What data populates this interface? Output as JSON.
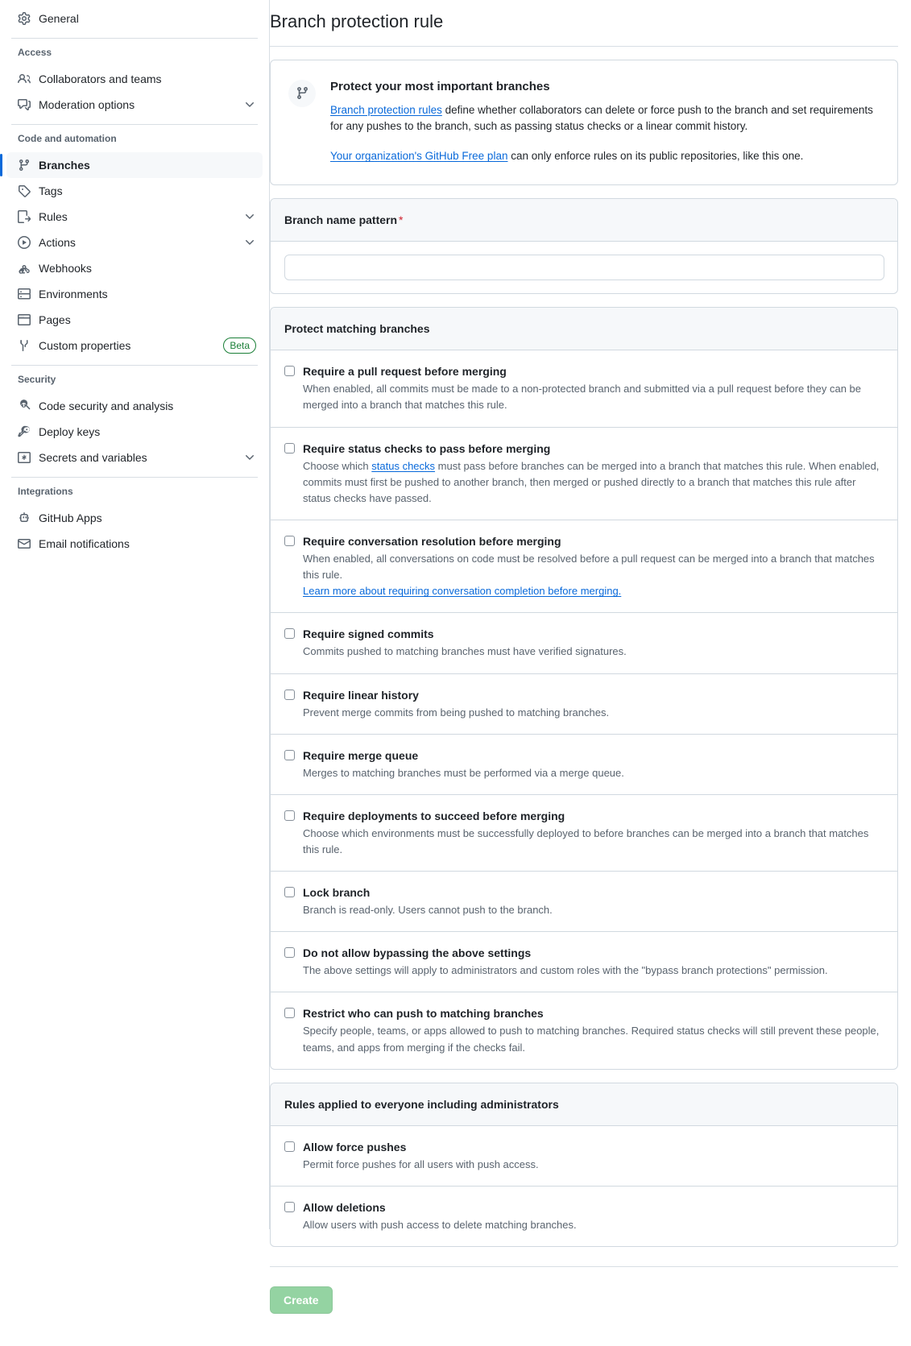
{
  "sidebar": {
    "top_items": [
      {
        "label": "General",
        "icon": "gear-icon",
        "name": "sidebar-item-general"
      }
    ],
    "groups": [
      {
        "heading": "Access",
        "items": [
          {
            "label": "Collaborators and teams",
            "icon": "people-icon",
            "name": "sidebar-item-collaborators-and-teams",
            "chevron": false
          },
          {
            "label": "Moderation options",
            "icon": "comment-discussion-icon",
            "name": "sidebar-item-moderation-options",
            "chevron": true
          }
        ]
      },
      {
        "heading": "Code and automation",
        "items": [
          {
            "label": "Branches",
            "icon": "git-branch-icon",
            "name": "sidebar-item-branches",
            "chevron": false,
            "active": true
          },
          {
            "label": "Tags",
            "icon": "tag-icon",
            "name": "sidebar-item-tags",
            "chevron": false
          },
          {
            "label": "Rules",
            "icon": "rules-icon",
            "name": "sidebar-item-rules",
            "chevron": true
          },
          {
            "label": "Actions",
            "icon": "play-icon",
            "name": "sidebar-item-actions",
            "chevron": true
          },
          {
            "label": "Webhooks",
            "icon": "webhook-icon",
            "name": "sidebar-item-webhooks",
            "chevron": false
          },
          {
            "label": "Environments",
            "icon": "server-icon",
            "name": "sidebar-item-environments",
            "chevron": false
          },
          {
            "label": "Pages",
            "icon": "browser-icon",
            "name": "sidebar-item-pages",
            "chevron": false
          },
          {
            "label": "Custom properties",
            "icon": "tools-icon",
            "name": "sidebar-item-custom-properties",
            "chevron": false,
            "badge": "Beta"
          }
        ]
      },
      {
        "heading": "Security",
        "items": [
          {
            "label": "Code security and analysis",
            "icon": "codescan-icon",
            "name": "sidebar-item-code-security-and-analysis",
            "chevron": false
          },
          {
            "label": "Deploy keys",
            "icon": "key-icon",
            "name": "sidebar-item-deploy-keys",
            "chevron": false
          },
          {
            "label": "Secrets and variables",
            "icon": "asterisk-box-icon",
            "name": "sidebar-item-secrets-and-variables",
            "chevron": true
          }
        ]
      },
      {
        "heading": "Integrations",
        "items": [
          {
            "label": "GitHub Apps",
            "icon": "apps-icon",
            "name": "sidebar-item-github-apps",
            "chevron": false
          },
          {
            "label": "Email notifications",
            "icon": "mail-icon",
            "name": "sidebar-item-email-notifications",
            "chevron": false
          }
        ]
      }
    ]
  },
  "main": {
    "page_title": "Branch protection rule",
    "callout": {
      "icon": "git-branch-icon",
      "title": "Protect your most important branches",
      "p1_link": "Branch protection rules",
      "p1_rest": " define whether collaborators can delete or force push to the branch and set requirements for any pushes to the branch, such as passing status checks or a linear commit history.",
      "p2_link": "Your organization's GitHub Free plan",
      "p2_rest": " can only enforce rules on its public repositories, like this one."
    },
    "branch_pattern": {
      "header": "Branch name pattern",
      "required_marker": "*",
      "value": "",
      "placeholder": ""
    },
    "protect_section": {
      "header": "Protect matching branches",
      "rules": [
        {
          "name": "require-pull-request",
          "title": "Require a pull request before merging",
          "desc": "When enabled, all commits must be made to a non-protected branch and submitted via a pull request before they can be merged into a branch that matches this rule.",
          "checked": false
        },
        {
          "name": "require-status-checks",
          "title": "Require status checks to pass before merging",
          "desc_pre": "Choose which ",
          "desc_link": "status checks",
          "desc_post": " must pass before branches can be merged into a branch that matches this rule. When enabled, commits must first be pushed to another branch, then merged or pushed directly to a branch that matches this rule after status checks have passed.",
          "checked": false
        },
        {
          "name": "require-conversation-resolution",
          "title": "Require conversation resolution before merging",
          "desc": "When enabled, all conversations on code must be resolved before a pull request can be merged into a branch that matches this rule.",
          "desc_link": "Learn more about requiring conversation completion before merging.",
          "checked": false
        },
        {
          "name": "require-signed-commits",
          "title": "Require signed commits",
          "desc": "Commits pushed to matching branches must have verified signatures.",
          "checked": false
        },
        {
          "name": "require-linear-history",
          "title": "Require linear history",
          "desc": "Prevent merge commits from being pushed to matching branches.",
          "checked": false
        },
        {
          "name": "require-merge-queue",
          "title": "Require merge queue",
          "desc": "Merges to matching branches must be performed via a merge queue.",
          "checked": false
        },
        {
          "name": "require-deployments",
          "title": "Require deployments to succeed before merging",
          "desc": "Choose which environments must be successfully deployed to before branches can be merged into a branch that matches this rule.",
          "checked": false
        },
        {
          "name": "lock-branch",
          "title": "Lock branch",
          "desc": "Branch is read-only. Users cannot push to the branch.",
          "checked": false
        },
        {
          "name": "do-not-allow-bypassing",
          "title": "Do not allow bypassing the above settings",
          "desc": "The above settings will apply to administrators and custom roles with the \"bypass branch protections\" permission.",
          "checked": false
        },
        {
          "name": "restrict-who-can-push",
          "title": "Restrict who can push to matching branches",
          "desc": "Specify people, teams, or apps allowed to push to matching branches. Required status checks will still prevent these people, teams, and apps from merging if the checks fail.",
          "checked": false
        }
      ]
    },
    "admin_section": {
      "header": "Rules applied to everyone including administrators",
      "rules": [
        {
          "name": "allow-force-pushes",
          "title": "Allow force pushes",
          "desc": "Permit force pushes for all users with push access.",
          "checked": false
        },
        {
          "name": "allow-deletions",
          "title": "Allow deletions",
          "desc": "Allow users with push access to delete matching branches.",
          "checked": false
        }
      ]
    },
    "submit": {
      "label": "Create",
      "disabled": true
    }
  },
  "colors": {
    "accent": "#0969da",
    "link": "#0969da",
    "required": "#cf222e",
    "beta_badge": "#1a7f37",
    "button_disabled_green": "#94d3a2",
    "border": "#d1d9e0",
    "muted_text": "#59636e",
    "header_bg": "#f6f8fa"
  }
}
